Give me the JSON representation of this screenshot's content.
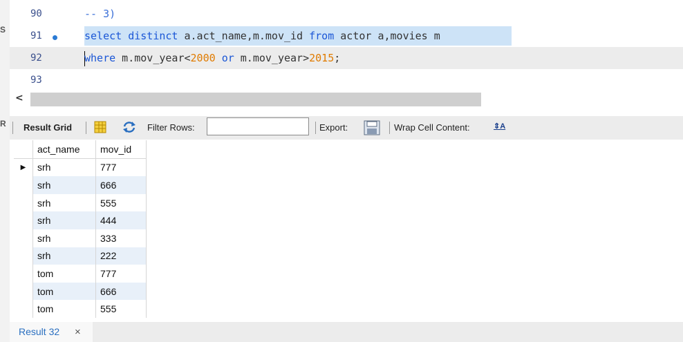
{
  "editor": {
    "lines": [
      {
        "number": "90",
        "tokens": [
          {
            "t": "-- 3)",
            "c": "cmt"
          }
        ]
      },
      {
        "number": "91",
        "tokens": [
          {
            "t": "select distinct",
            "c": "kw"
          },
          {
            "t": " a.act_name,m.mov_id ",
            "c": ""
          },
          {
            "t": "from",
            "c": "kw"
          },
          {
            "t": " actor a,movies m",
            "c": ""
          }
        ]
      },
      {
        "number": "92",
        "tokens": [
          {
            "t": "where",
            "c": "kw"
          },
          {
            "t": " m.mov_year<",
            "c": ""
          },
          {
            "t": "2000",
            "c": "num"
          },
          {
            "t": " ",
            "c": ""
          },
          {
            "t": "or",
            "c": "kw"
          },
          {
            "t": " m.mov_year>",
            "c": ""
          },
          {
            "t": "2015",
            "c": "num"
          },
          {
            "t": ";",
            "c": ""
          }
        ]
      },
      {
        "number": "93",
        "tokens": []
      }
    ]
  },
  "scrollbar": {
    "left_arrow": "<"
  },
  "toolbar": {
    "result_grid": "Result Grid",
    "filter_rows": "Filter Rows:",
    "filter_value": "",
    "export": "Export:",
    "wrap_cell": "Wrap Cell Content:"
  },
  "grid": {
    "columns": [
      "act_name",
      "mov_id"
    ],
    "rows": [
      [
        "srh",
        "777"
      ],
      [
        "srh",
        "666"
      ],
      [
        "srh",
        "555"
      ],
      [
        "srh",
        "444"
      ],
      [
        "srh",
        "333"
      ],
      [
        "srh",
        "222"
      ],
      [
        "tom",
        "777"
      ],
      [
        "tom",
        "666"
      ],
      [
        "tom",
        "555"
      ]
    ]
  },
  "tabs": {
    "result": "Result 32",
    "close": "×"
  },
  "sidebar_glyphs": [
    "S",
    "R"
  ]
}
